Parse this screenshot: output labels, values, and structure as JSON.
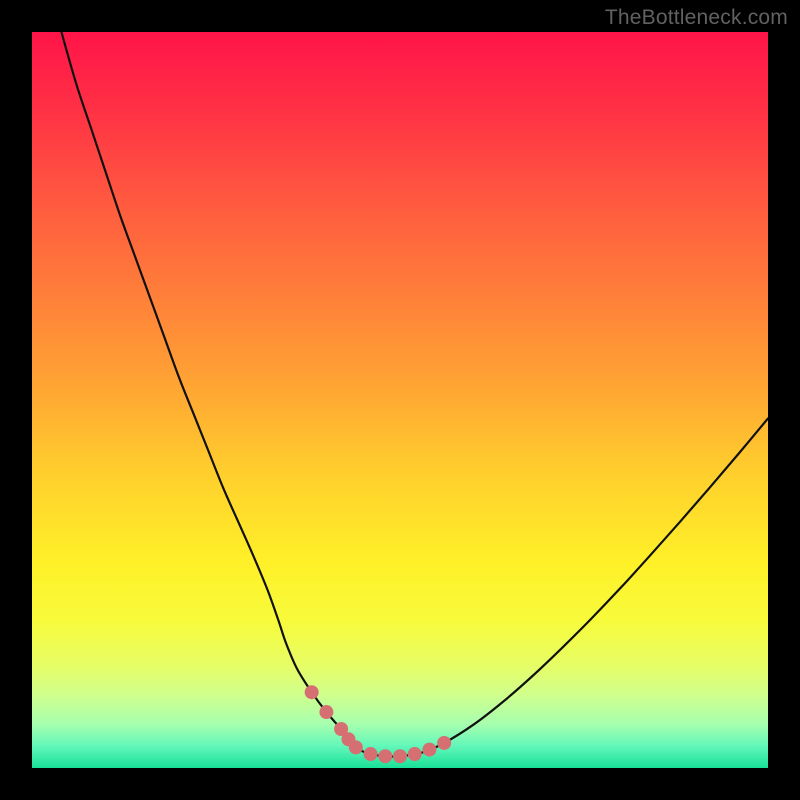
{
  "watermark": {
    "text": "TheBottleneck.com"
  },
  "colors": {
    "frame": "#000000",
    "curve": "#111111",
    "markers": "#d56f72",
    "gradient_stops": [
      {
        "offset": 0.0,
        "color": "#ff1449"
      },
      {
        "offset": 0.1,
        "color": "#ff2f45"
      },
      {
        "offset": 0.22,
        "color": "#ff5640"
      },
      {
        "offset": 0.35,
        "color": "#ff7d3a"
      },
      {
        "offset": 0.48,
        "color": "#ffa433"
      },
      {
        "offset": 0.6,
        "color": "#ffcf2d"
      },
      {
        "offset": 0.72,
        "color": "#fff028"
      },
      {
        "offset": 0.8,
        "color": "#f7fb3b"
      },
      {
        "offset": 0.86,
        "color": "#e7fd65"
      },
      {
        "offset": 0.9,
        "color": "#d0ff8c"
      },
      {
        "offset": 0.94,
        "color": "#a7ffae"
      },
      {
        "offset": 0.97,
        "color": "#63f7ba"
      },
      {
        "offset": 1.0,
        "color": "#19e098"
      }
    ]
  },
  "chart_data": {
    "type": "line",
    "title": "",
    "xlabel": "",
    "ylabel": "",
    "xlim": [
      0,
      100
    ],
    "ylim": [
      0,
      100
    ],
    "grid": false,
    "legend": false,
    "series": [
      {
        "name": "bottleneck-curve",
        "x": [
          4,
          6,
          8,
          10,
          12,
          14,
          16,
          18,
          20,
          22,
          24,
          26,
          28,
          30,
          32,
          33.5,
          34.5,
          36,
          38,
          40,
          42,
          43.5,
          44.5,
          46,
          48,
          50,
          53,
          56,
          60,
          64,
          68,
          72,
          76,
          80,
          84,
          88,
          92,
          96,
          100
        ],
        "y": [
          100,
          93,
          87,
          81,
          75,
          69.5,
          64,
          58.5,
          53,
          48,
          43,
          38,
          33.5,
          29,
          24.2,
          20,
          17,
          13.5,
          10.3,
          7.6,
          5.3,
          3.7,
          2.5,
          1.9,
          1.6,
          1.6,
          2.1,
          3.4,
          5.9,
          9.0,
          12.5,
          16.3,
          20.3,
          24.5,
          28.9,
          33.4,
          38.0,
          42.7,
          47.5
        ]
      }
    ],
    "markers": {
      "name": "highlight-points",
      "x": [
        38,
        40,
        42,
        43,
        44,
        46,
        48,
        50,
        52,
        54,
        56
      ],
      "y": [
        10.3,
        7.6,
        5.3,
        3.9,
        2.8,
        1.9,
        1.6,
        1.6,
        1.9,
        2.5,
        3.4
      ]
    }
  }
}
